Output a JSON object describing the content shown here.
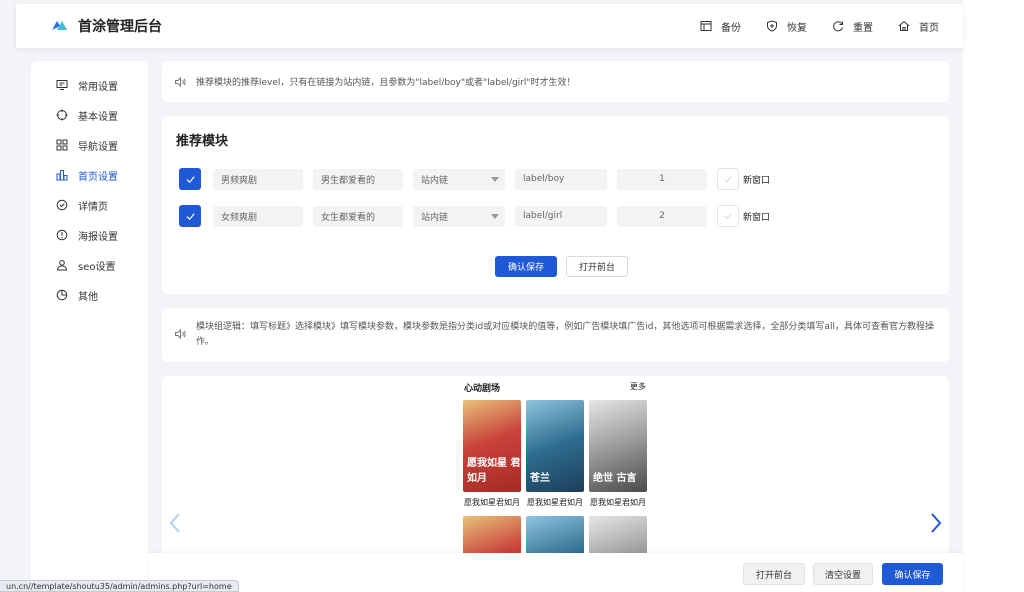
{
  "app": {
    "title": "首涂管理后台",
    "brand_color": "#1f59d6"
  },
  "header": {
    "actions": [
      {
        "label": "备份",
        "icon": "backup-icon"
      },
      {
        "label": "恢复",
        "icon": "shield-icon"
      },
      {
        "label": "重置",
        "icon": "refresh-icon"
      },
      {
        "label": "首页",
        "icon": "home-icon"
      }
    ]
  },
  "sidebar": {
    "items": [
      {
        "label": "常用设置",
        "icon": "monitor-icon",
        "active": false
      },
      {
        "label": "基本设置",
        "icon": "crosshair-icon",
        "active": false
      },
      {
        "label": "导航设置",
        "icon": "grid-icon",
        "active": false
      },
      {
        "label": "首页设置",
        "icon": "bar-chart-icon",
        "active": true
      },
      {
        "label": "详情页",
        "icon": "check-circle-icon",
        "active": false
      },
      {
        "label": "海报设置",
        "icon": "info-circle-icon",
        "active": false
      },
      {
        "label": "seo设置",
        "icon": "user-icon",
        "active": false
      },
      {
        "label": "其他",
        "icon": "pie-icon",
        "active": false
      }
    ]
  },
  "notice1": {
    "text": "推荐模块的推荐level，只有在链接为站内链，且参数为\"label/boy\"或者\"label/girl\"时才生效！"
  },
  "module": {
    "title": "推荐模块",
    "rows": [
      {
        "checked": true,
        "name": "男频爽剧",
        "subtitle": "男生都爱看的",
        "link_type": "站内链",
        "param": "label/boy",
        "level": "1",
        "new_window": false,
        "new_window_label": "新窗口"
      },
      {
        "checked": true,
        "name": "女频爽剧",
        "subtitle": "女生都爱看的",
        "link_type": "站内链",
        "param": "label/girl",
        "level": "2",
        "new_window": false,
        "new_window_label": "新窗口"
      }
    ],
    "save_label": "确认保存",
    "open_front_label": "打开前台"
  },
  "notice2": {
    "text": "模块组逻辑：填写标题》选择模块》填写模块参数，模块参数是指分类id或对应模块的值等，例如广告模块填广告id，其他选项可根据需求选择，全部分类填写all，具体可查看官方教程操作。"
  },
  "preview": {
    "section_title": "心动剧场",
    "more_label": "更多",
    "posters": [
      {
        "title": "愿我如星君如月",
        "overlay": "愿我如星\n君如月"
      },
      {
        "title": "愿我如星君如月",
        "overlay": "苍兰"
      },
      {
        "title": "愿我如星君如月",
        "overlay": "绝世\n古言"
      }
    ]
  },
  "bottom": {
    "open_front_label": "打开前台",
    "clear_label": "清空设置",
    "save_label": "确认保存"
  },
  "status_url": "un.cn//template/shoutu35/admin/admins.php?url=home"
}
